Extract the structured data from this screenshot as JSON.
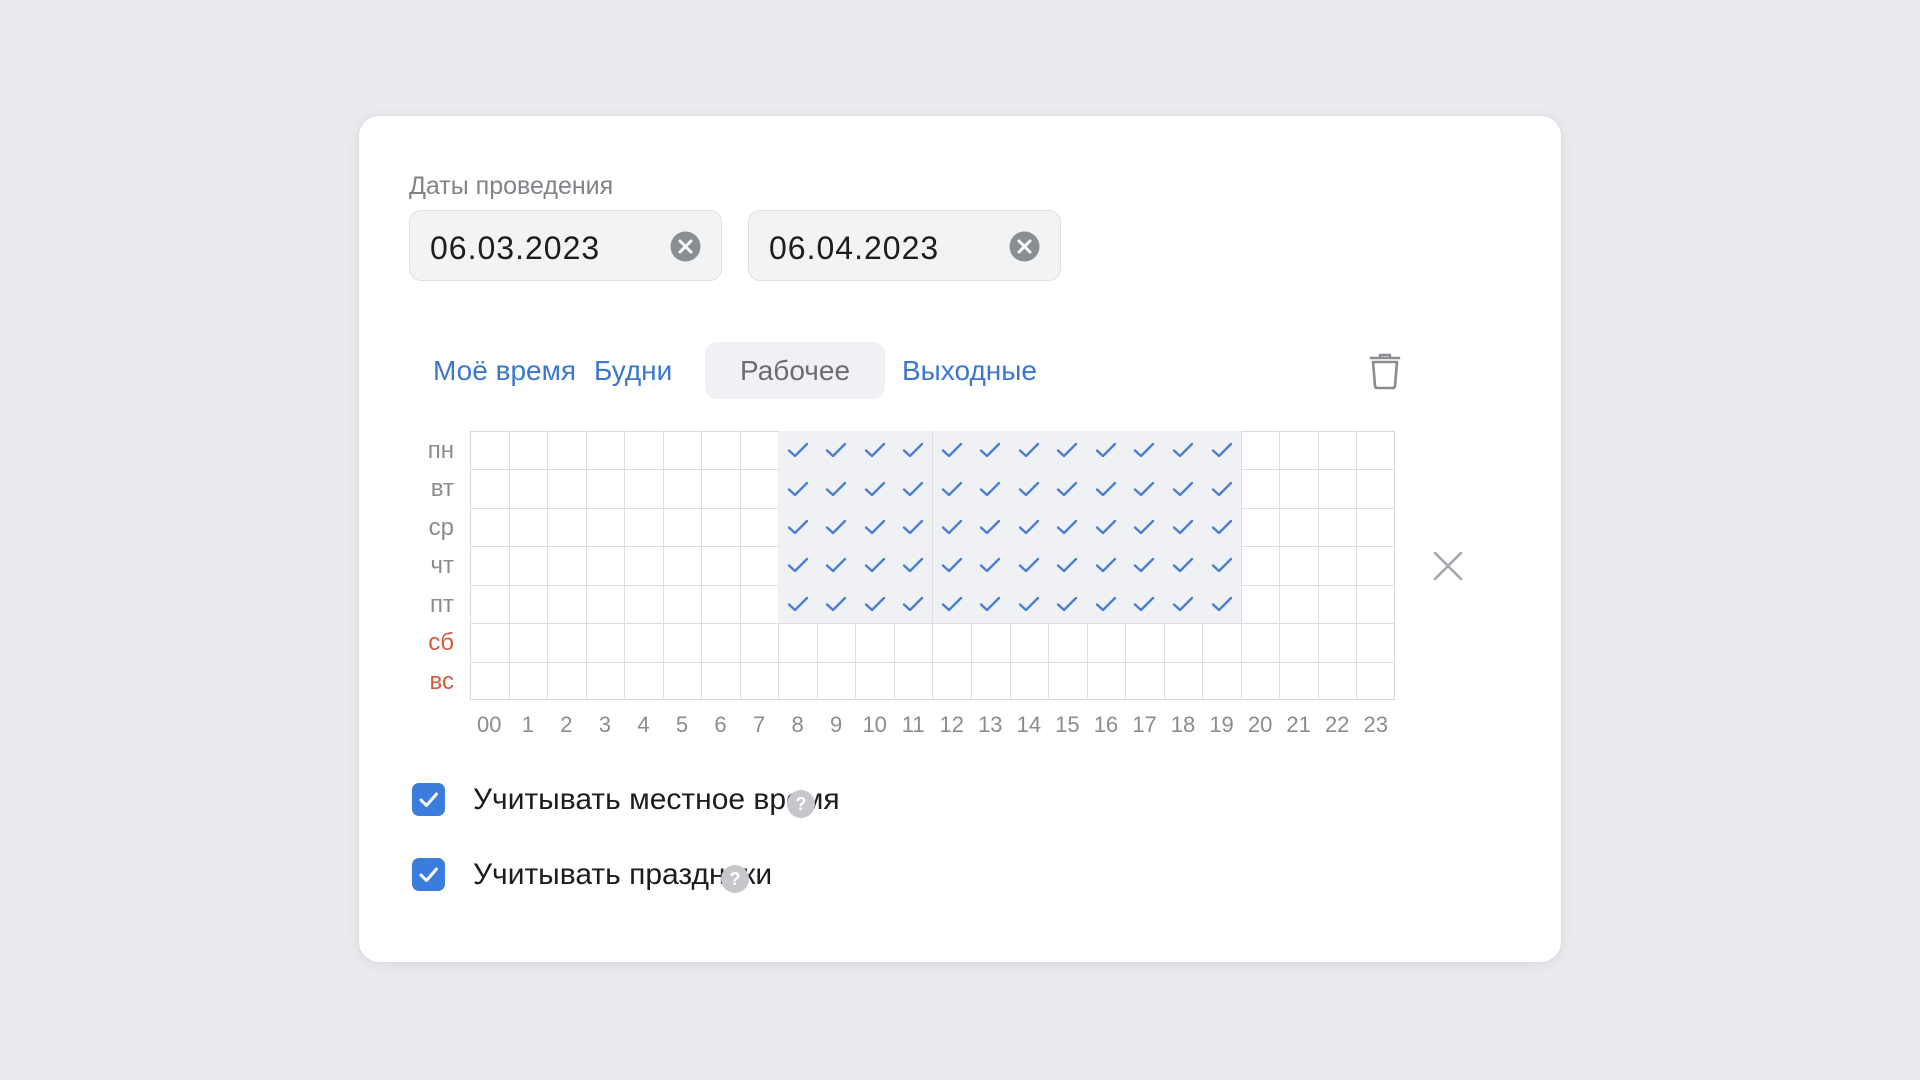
{
  "dates": {
    "label": "Даты проведения",
    "from": "06.03.2023",
    "to": "06.04.2023"
  },
  "tabs": [
    {
      "label": "Моё время",
      "active": false
    },
    {
      "label": "Будни",
      "active": false
    },
    {
      "label": "Рабочее",
      "active": true
    },
    {
      "label": "Выходные",
      "active": false
    }
  ],
  "schedule": {
    "days": [
      {
        "label": "пн",
        "weekend": false,
        "hours": [
          8,
          9,
          10,
          11,
          12,
          13,
          14,
          15,
          16,
          17,
          18,
          19
        ]
      },
      {
        "label": "вт",
        "weekend": false,
        "hours": [
          8,
          9,
          10,
          11,
          12,
          13,
          14,
          15,
          16,
          17,
          18,
          19
        ]
      },
      {
        "label": "ср",
        "weekend": false,
        "hours": [
          8,
          9,
          10,
          11,
          12,
          13,
          14,
          15,
          16,
          17,
          18,
          19
        ]
      },
      {
        "label": "чт",
        "weekend": false,
        "hours": [
          8,
          9,
          10,
          11,
          12,
          13,
          14,
          15,
          16,
          17,
          18,
          19
        ]
      },
      {
        "label": "пт",
        "weekend": false,
        "hours": [
          8,
          9,
          10,
          11,
          12,
          13,
          14,
          15,
          16,
          17,
          18,
          19
        ]
      },
      {
        "label": "сб",
        "weekend": true,
        "hours": []
      },
      {
        "label": "вс",
        "weekend": true,
        "hours": []
      }
    ],
    "hour_labels": [
      "00",
      "1",
      "2",
      "3",
      "4",
      "5",
      "6",
      "7",
      "8",
      "9",
      "10",
      "11",
      "12",
      "13",
      "14",
      "15",
      "16",
      "17",
      "18",
      "19",
      "20",
      "21",
      "22",
      "23"
    ]
  },
  "options": [
    {
      "label": "Учитывать местное время",
      "checked": true
    },
    {
      "label": "Учитывать праздники",
      "checked": true
    }
  ],
  "colors": {
    "accent": "#3b7ddd",
    "link": "#3b77d1",
    "weekend": "#d45b3c",
    "check": "#4a7fcf"
  },
  "icons": {
    "clear": "clear-circle-icon",
    "trash": "trash-icon",
    "close": "close-icon",
    "help": "question-icon",
    "check": "checkmark-icon"
  }
}
